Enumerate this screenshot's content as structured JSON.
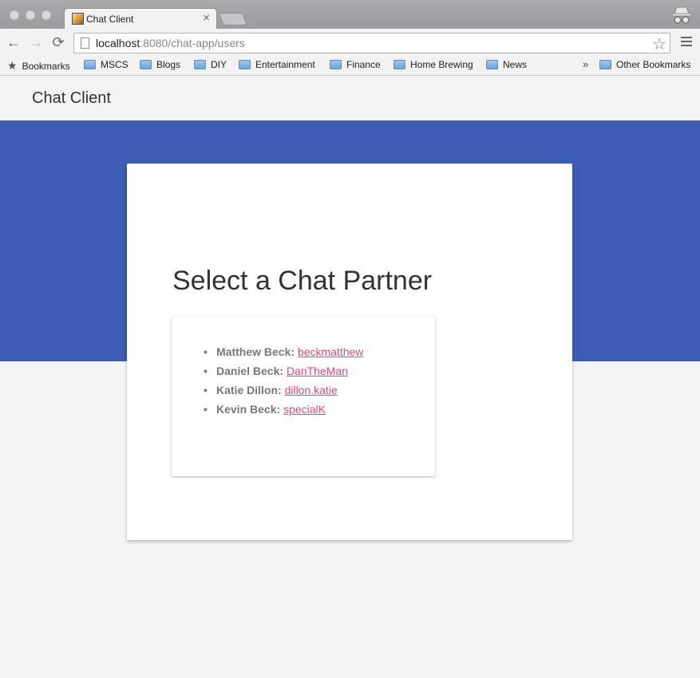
{
  "browser": {
    "tab_title": "Chat Client",
    "tab_close": "×",
    "url_host": "localhost",
    "url_rest": ":8080/chat-app/users",
    "nav": {
      "back": "←",
      "forward": "→",
      "reload": "⟳"
    },
    "star": "☆",
    "bookmarks": [
      {
        "label": "Bookmarks",
        "icon": "star-icon"
      },
      {
        "label": "MSCS",
        "icon": "folder-icon"
      },
      {
        "label": "Blogs",
        "icon": "folder-icon"
      },
      {
        "label": "DIY",
        "icon": "folder-icon"
      },
      {
        "label": "Entertainment",
        "icon": "folder-icon"
      },
      {
        "label": "Finance",
        "icon": "folder-icon"
      },
      {
        "label": "Home Brewing",
        "icon": "folder-icon"
      },
      {
        "label": "News",
        "icon": "folder-icon"
      }
    ],
    "overflow": "»",
    "other_bookmarks": "Other Bookmarks"
  },
  "app": {
    "title": "Chat Client",
    "heading": "Select a Chat Partner",
    "users": [
      {
        "name": "Matthew Beck:",
        "handle": "beckmatthew"
      },
      {
        "name": "Daniel Beck:",
        "handle": "DanTheMan"
      },
      {
        "name": "Katie Dillon:",
        "handle": "dillon.katie"
      },
      {
        "name": "Kevin Beck:",
        "handle": "specialK"
      }
    ]
  },
  "colors": {
    "banner": "#3d5db4",
    "link": "#e0457b"
  }
}
